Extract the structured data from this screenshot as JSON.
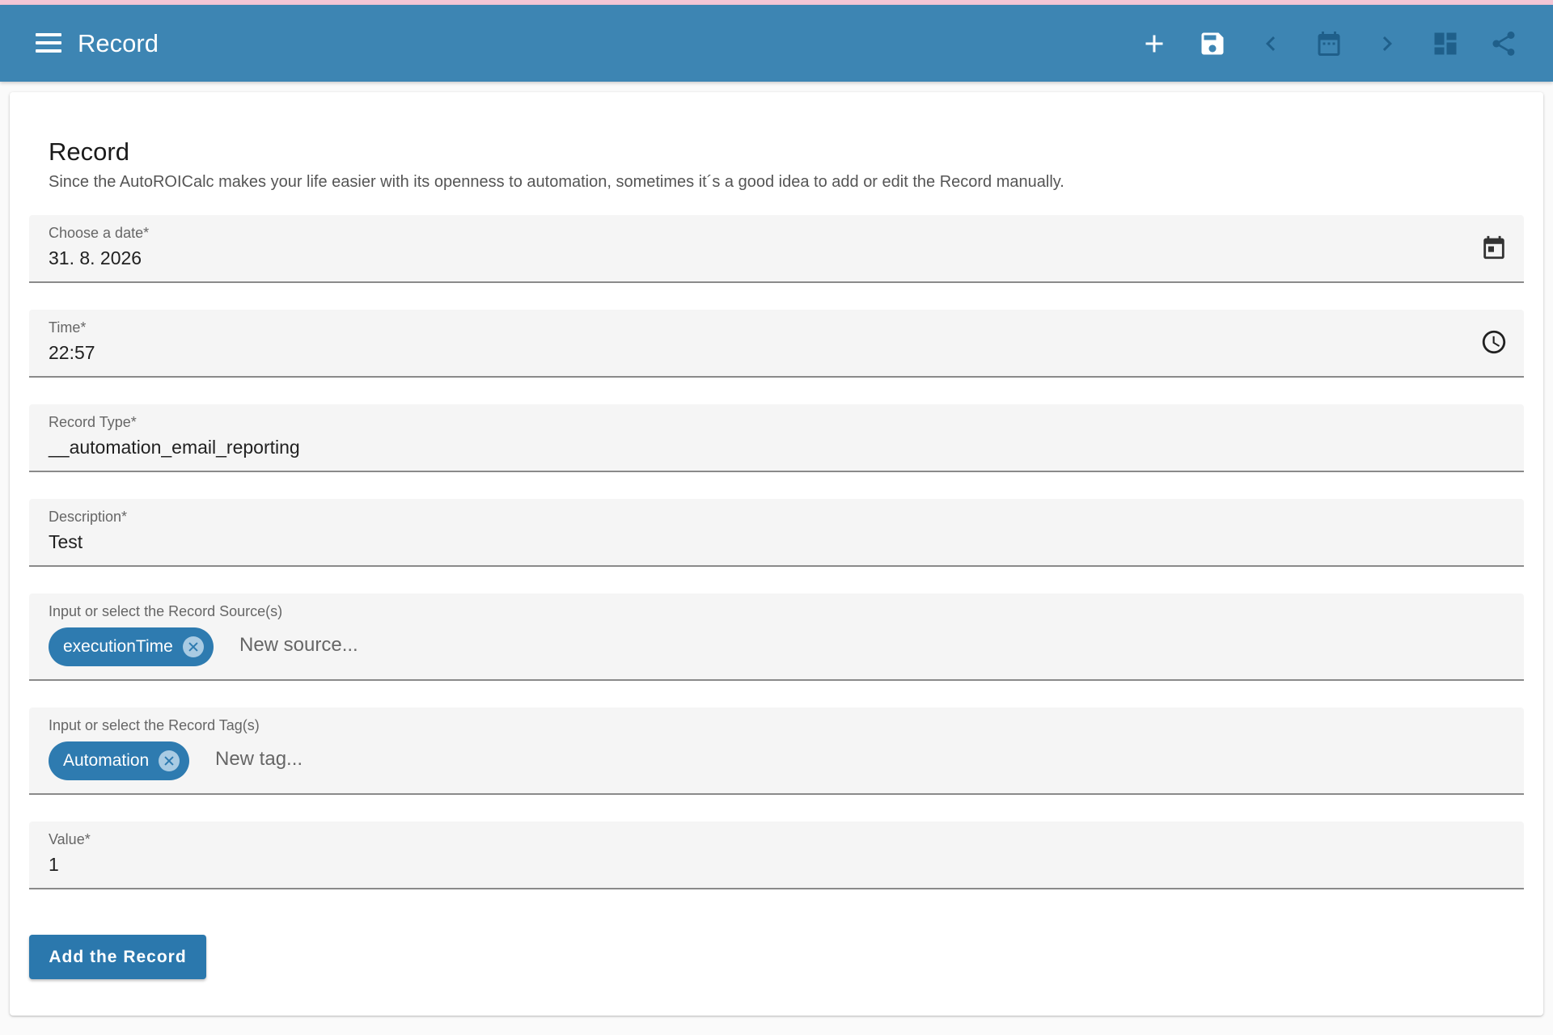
{
  "appbar": {
    "title": "Record",
    "icons": [
      "menu-icon",
      "add-icon",
      "save-icon",
      "chevron-left-icon",
      "calendar-icon",
      "chevron-right-icon",
      "dashboard-icon",
      "share-icon"
    ],
    "color": "#3d85b3"
  },
  "card": {
    "title": "Record",
    "subtitle": "Since the AutoROICalc makes your life easier with its openness to automation, sometimes it´s a good idea to add or edit the Record manually."
  },
  "fields": {
    "date": {
      "label": "Choose a date*",
      "value": "31. 8. 2026"
    },
    "time": {
      "label": "Time*",
      "value": "22:57"
    },
    "record_type": {
      "label": "Record Type*",
      "value": "__automation_email_reporting"
    },
    "description": {
      "label": "Description*",
      "value": "Test"
    },
    "sources": {
      "label": "Input or select the Record Source(s)",
      "chips": [
        "executionTime"
      ],
      "placeholder": "New source..."
    },
    "tags": {
      "label": "Input or select the Record Tag(s)",
      "chips": [
        "Automation"
      ],
      "placeholder": "New tag..."
    },
    "value": {
      "label": "Value*",
      "value": "1"
    }
  },
  "submit_label": "Add the Record",
  "accent_color": "#2e7bb0"
}
